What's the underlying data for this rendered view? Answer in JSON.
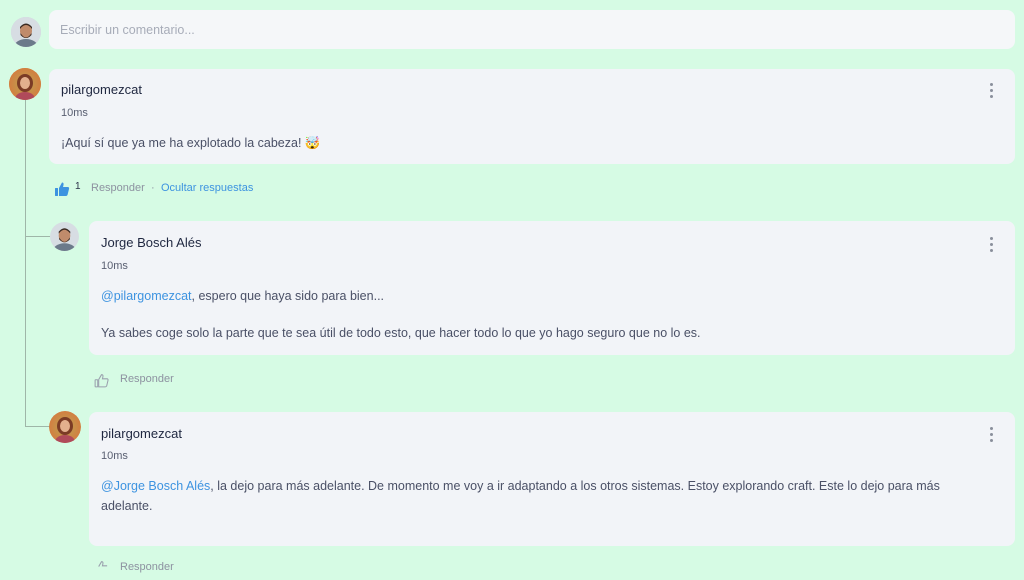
{
  "composer": {
    "placeholder": "Escribir un comentario..."
  },
  "comments": [
    {
      "author": "pilargomezcat",
      "time": "10ms",
      "text": "¡Aquí sí que ya me ha explotado la cabeza! 🤯",
      "likes": "1",
      "reply_label": "Responder",
      "separator": "·",
      "hide_label": "Ocultar respuestas"
    }
  ],
  "replies": [
    {
      "author": "Jorge Bosch Alés",
      "time": "10ms",
      "mention": "@pilargomezcat",
      "text_after_mention": ", espero que haya sido para bien...",
      "paragraph2": "Ya sabes coge solo la parte que te sea útil de todo esto, que hacer todo lo que yo hago seguro que no lo es.",
      "reply_label": "Responder"
    },
    {
      "author": "pilargomezcat",
      "time": "10ms",
      "mention": "@Jorge Bosch Alés",
      "text_after_mention": ", la dejo para más adelante. De momento me voy a ir adaptando a los otros sistemas. Estoy explorando craft. Este lo dejo para más adelante.",
      "reply_label": "Responder"
    }
  ],
  "colors": {
    "background": "#d6fbe4",
    "card": "#f2f4f8",
    "accent": "#3d93e0"
  },
  "icons": [
    "kebab-menu-icon",
    "thumbs-up-filled-icon",
    "thumbs-up-outline-icon"
  ]
}
